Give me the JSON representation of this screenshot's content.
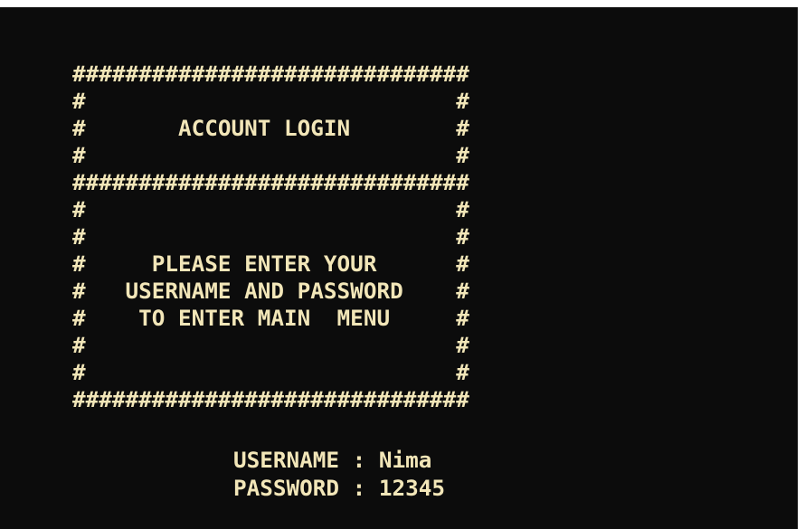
{
  "console": {
    "background": "#0c0c0c",
    "text_color": "#f2e6b8",
    "lines": [
      "##############################",
      "#                            #",
      "#       ACCOUNT LOGIN        #",
      "#                            #",
      "##############################",
      "#                            #",
      "#                            #",
      "#     PLEASE ENTER YOUR      #",
      "#   USERNAME AND PASSWORD    #",
      "#    TO ENTER MAIN  MENU     #",
      "#                            #",
      "#                            #",
      "##############################"
    ],
    "username_label": "USERNAME",
    "username_value": "Nima",
    "password_label": "PASSWORD",
    "password_value": "12345"
  }
}
